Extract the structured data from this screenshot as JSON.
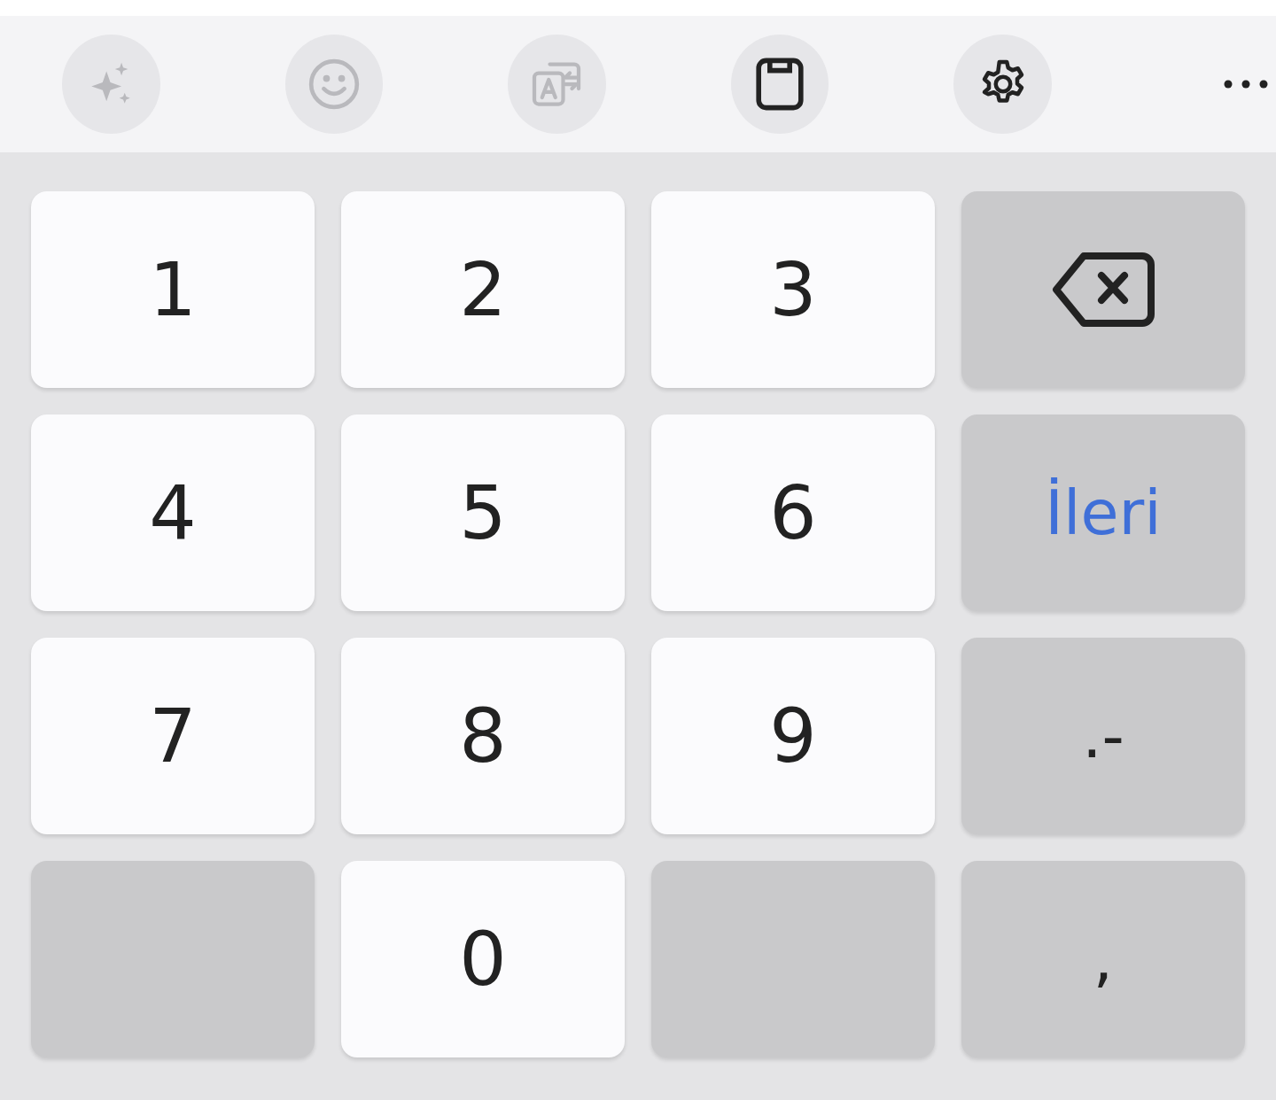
{
  "toolbar": [
    {
      "kind": "sparkles",
      "disabled": true
    },
    {
      "kind": "emoji",
      "disabled": true
    },
    {
      "kind": "translate",
      "disabled": true
    },
    {
      "kind": "clipboard",
      "disabled": false
    },
    {
      "kind": "settings",
      "disabled": false
    }
  ],
  "keys": [
    {
      "kind": "digit",
      "label": "1"
    },
    {
      "kind": "digit",
      "label": "2"
    },
    {
      "kind": "digit",
      "label": "3"
    },
    {
      "kind": "backspace"
    },
    {
      "kind": "digit",
      "label": "4"
    },
    {
      "kind": "digit",
      "label": "5"
    },
    {
      "kind": "digit",
      "label": "6"
    },
    {
      "kind": "action",
      "label": "İleri"
    },
    {
      "kind": "digit",
      "label": "7"
    },
    {
      "kind": "digit",
      "label": "8"
    },
    {
      "kind": "digit",
      "label": "9"
    },
    {
      "kind": "symbol",
      "label": ".-"
    },
    {
      "kind": "blank"
    },
    {
      "kind": "digit",
      "label": "0"
    },
    {
      "kind": "blank"
    },
    {
      "kind": "symbol",
      "label": ","
    }
  ]
}
